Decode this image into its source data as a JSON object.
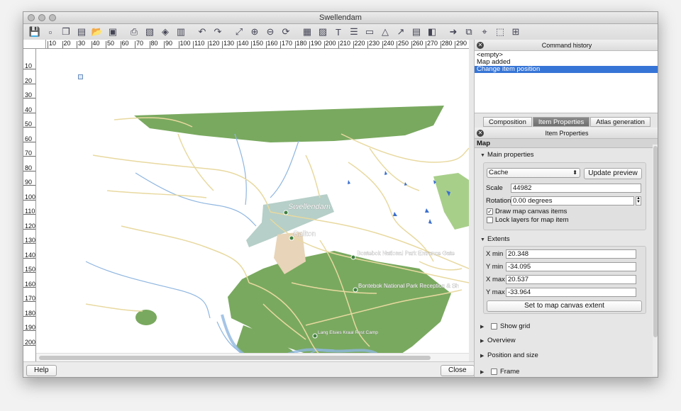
{
  "window": {
    "title": "Swellendam"
  },
  "toolbar": {
    "icons": [
      "save-icon",
      "new-composer-icon",
      "duplicate-composer-icon",
      "composer-manager-icon",
      "open-folder-icon",
      "save-template-icon",
      "print-icon",
      "export-image-icon",
      "export-svg-icon",
      "export-pdf-icon",
      "undo-icon",
      "redo-icon",
      "zoom-full-icon",
      "zoom-in-icon",
      "zoom-out-icon",
      "refresh-icon",
      "add-map-icon",
      "add-image-icon",
      "add-label-icon",
      "add-legend-icon",
      "add-scalebar-icon",
      "add-shape-icon",
      "add-arrow-icon",
      "add-table-icon",
      "add-html-icon",
      "select-move-icon",
      "move-content-icon",
      "edit-nodes-icon",
      "group-icon",
      "align-icon"
    ]
  },
  "ruler": {
    "h_ticks": [
      "10",
      "20",
      "30",
      "40",
      "50",
      "60",
      "70",
      "80",
      "90",
      "100",
      "110",
      "120",
      "130",
      "140",
      "150",
      "160",
      "170",
      "180",
      "190",
      "200",
      "210",
      "220",
      "230",
      "240",
      "250",
      "260",
      "270",
      "280",
      "290"
    ],
    "v_ticks": [
      "10",
      "20",
      "30",
      "40",
      "50",
      "60",
      "70",
      "80",
      "90",
      "100",
      "110",
      "120",
      "130",
      "140",
      "150",
      "160",
      "170",
      "180",
      "190",
      "200"
    ]
  },
  "map": {
    "places": {
      "town": "Swellendam",
      "station": "Railton",
      "poi1": "Bontebok National Park Entrance Gate",
      "poi2": "Bontebok National Park Reception & Sh",
      "poi3": "Lang Elsies Kraal Rest Camp"
    },
    "colors": {
      "park": "#79a95f",
      "road": "#e8d9a0",
      "water": "#8fb6e0",
      "urban": "#b6cfc8"
    }
  },
  "bottom": {
    "help": "Help",
    "close": "Close"
  },
  "history": {
    "title": "Command history",
    "items": [
      "<empty>",
      "Map added",
      "Change item position"
    ],
    "selected_index": 2
  },
  "tabs": [
    "Composition",
    "Item Properties",
    "Atlas generation"
  ],
  "active_tab": "Item Properties",
  "item_properties": {
    "title": "Item Properties",
    "section": "Map",
    "main_properties": "Main properties",
    "cache_value": "Cache",
    "update_preview": "Update preview",
    "scale_label": "Scale",
    "scale_value": "44982",
    "rotation_label": "Rotation",
    "rotation_value": "0.00 degrees",
    "draw_canvas_items": "Draw map canvas items",
    "draw_canvas_items_checked": true,
    "lock_layers": "Lock layers for map item",
    "lock_layers_checked": false,
    "extents": "Extents",
    "xmin_label": "X min",
    "xmin": "20.348",
    "ymin_label": "Y min",
    "ymin": "-34.095",
    "xmax_label": "X max",
    "xmax": "20.537",
    "ymax_label": "Y max",
    "ymax": "-33.964",
    "set_extent": "Set to map canvas extent",
    "show_grid": "Show grid",
    "overview": "Overview",
    "position_size": "Position and size",
    "frame": "Frame"
  }
}
